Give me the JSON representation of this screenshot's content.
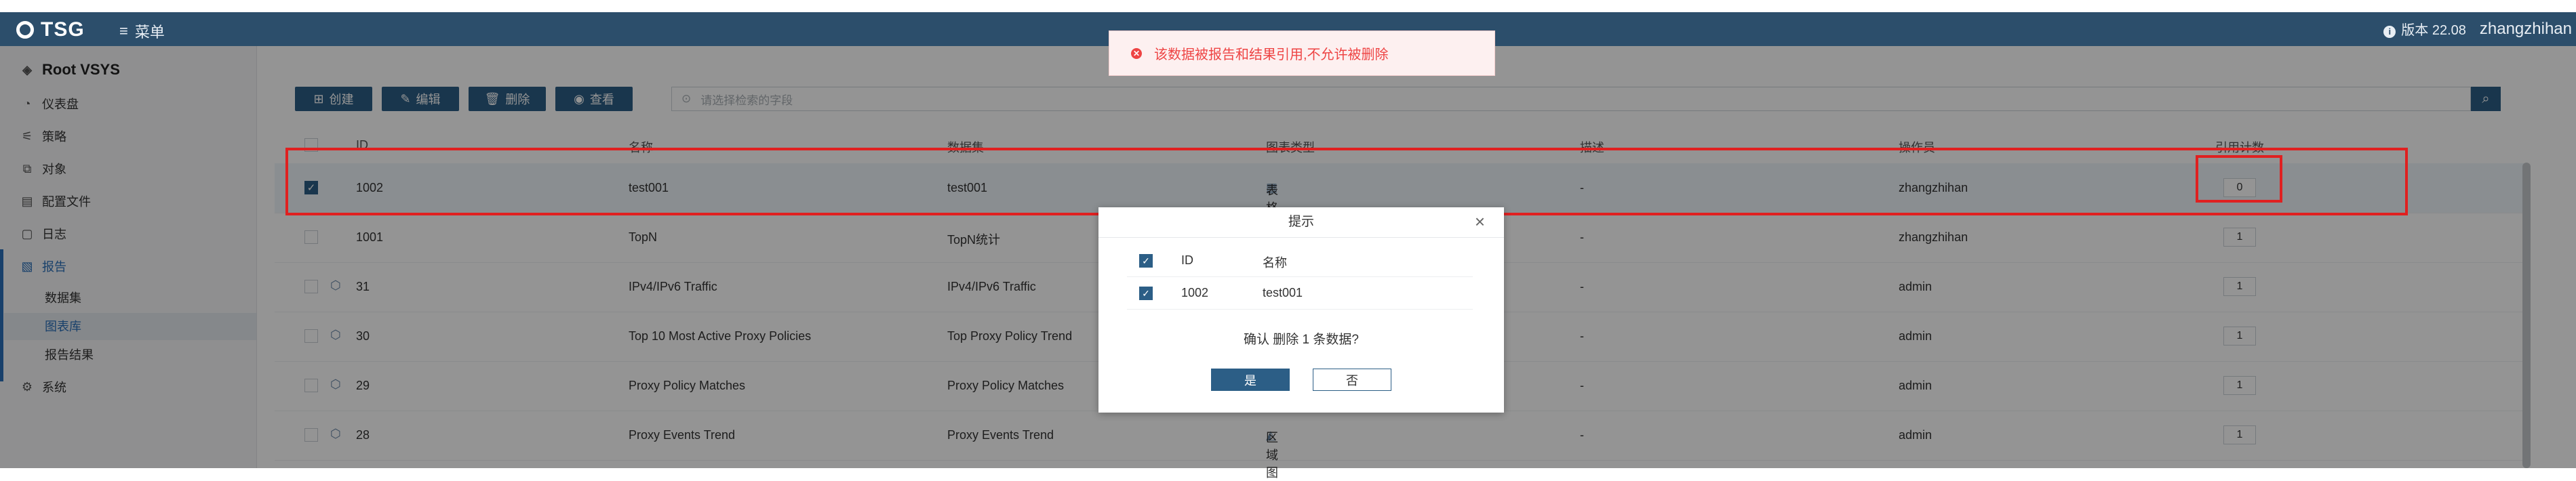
{
  "header": {
    "logo_text": "TSG",
    "menu_label": "菜单",
    "version_label": "版本 22.08",
    "username": "zhangzhihan"
  },
  "sidebar": {
    "vsys": "Root VSYS",
    "items": [
      {
        "label": "仪表盘",
        "icon": "dashboard-icon"
      },
      {
        "label": "策略",
        "icon": "policy-icon"
      },
      {
        "label": "对象",
        "icon": "object-icon"
      },
      {
        "label": "配置文件",
        "icon": "profile-icon"
      },
      {
        "label": "日志",
        "icon": "log-icon"
      },
      {
        "label": "报告",
        "icon": "report-icon"
      },
      {
        "label": "系统",
        "icon": "system-icon"
      }
    ],
    "subitems": [
      {
        "label": "数据集"
      },
      {
        "label": "图表库"
      },
      {
        "label": "报告结果"
      }
    ]
  },
  "toolbar": {
    "create": "创建",
    "edit": "编辑",
    "delete": "删除",
    "view": "查看",
    "search_placeholder": "请选择检索的字段"
  },
  "table": {
    "headers": [
      "ID",
      "名称",
      "数据集",
      "图表类型",
      "描述",
      "操作员",
      "引用计数"
    ],
    "rows": [
      {
        "id": "1002",
        "name": "test001",
        "dataset": "test001",
        "type": "表格",
        "desc": "-",
        "operator": "zhangzhihan",
        "count": "0",
        "selected": true
      },
      {
        "id": "1001",
        "name": "TopN",
        "dataset": "TopN统计",
        "type": "",
        "desc": "-",
        "operator": "zhangzhihan",
        "count": "1"
      },
      {
        "id": "31",
        "name": "IPv4/IPv6 Traffic",
        "dataset": "IPv4/IPv6 Traffic",
        "type": "",
        "desc": "-",
        "operator": "admin",
        "count": "1"
      },
      {
        "id": "30",
        "name": "Top 10 Most Active Proxy Policies",
        "dataset": "Top Proxy Policy Trend",
        "type": "",
        "desc": "-",
        "operator": "admin",
        "count": "1"
      },
      {
        "id": "29",
        "name": "Proxy Policy Matches",
        "dataset": "Proxy Policy Matches",
        "type": "",
        "desc": "-",
        "operator": "admin",
        "count": "1"
      },
      {
        "id": "28",
        "name": "Proxy Events Trend",
        "dataset": "Proxy Events Trend",
        "type": "区域图",
        "desc": "-",
        "operator": "admin",
        "count": "1"
      }
    ]
  },
  "toast": {
    "message": "该数据被报告和结果引用,不允许被删除"
  },
  "dialog": {
    "title": "提示",
    "col_id": "ID",
    "col_name": "名称",
    "row_id": "1002",
    "row_name": "test001",
    "message": "确认 删除 1 条数据?",
    "yes": "是",
    "no": "否"
  },
  "colors": {
    "header_bg": "#2c4e6b",
    "accent": "#2c5e86",
    "highlight": "#e02020",
    "error": "#e44444"
  }
}
